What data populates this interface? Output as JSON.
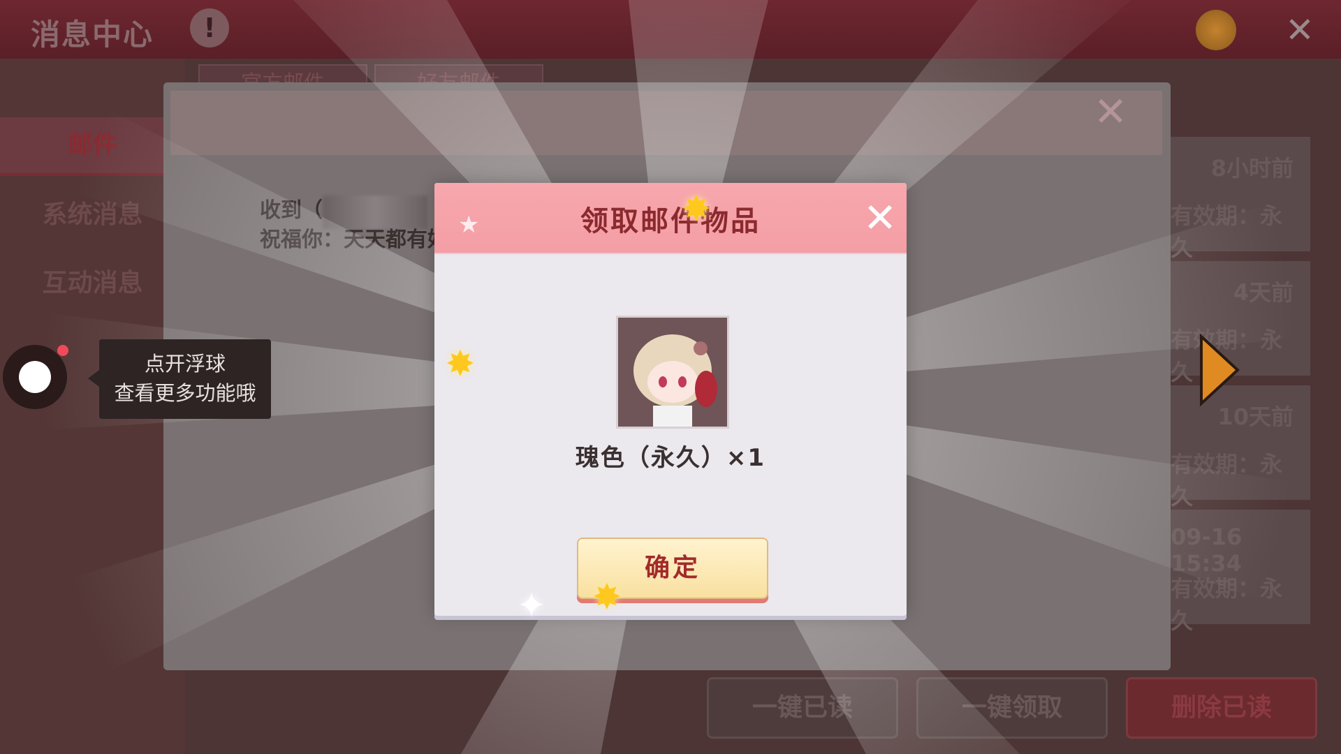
{
  "app": {
    "title": "消息中心",
    "info_icon": "info-icon",
    "coin_icon": "coin-icon",
    "close_icon": "close-icon"
  },
  "sidebar": {
    "items": [
      {
        "label": "邮件",
        "active": true
      },
      {
        "label": "系统消息",
        "active": false
      },
      {
        "label": "互动消息",
        "active": false
      }
    ]
  },
  "tabs": [
    {
      "label": "官方邮件"
    },
    {
      "label": "好友邮件"
    }
  ],
  "mail_list": [
    {
      "time": "8小时前",
      "validity": "有效期：永久"
    },
    {
      "time": "4天前",
      "validity": "有效期：永久"
    },
    {
      "time": "10天前",
      "validity": "有效期：永久"
    },
    {
      "time": "09-16 15:34",
      "validity": "有效期：永久"
    }
  ],
  "bottom_buttons": {
    "mark_read": "一键已读",
    "claim_all": "一键领取",
    "delete_read": "删除已读"
  },
  "mail_detail": {
    "received_prefix": "收到（",
    "blessing": "祝福你：天天都有好"
  },
  "float_tip": {
    "line1": "点开浮球",
    "line2": "查看更多功能哦"
  },
  "dialog": {
    "title": "领取邮件物品",
    "item_name": "瑰色（永久）×1",
    "confirm": "确定"
  },
  "colors": {
    "dialog_header": "#f49ea5",
    "title_red": "#8a2a2e",
    "confirm_bg": "#f9e0a0",
    "star_gold": "#ffc81e"
  }
}
